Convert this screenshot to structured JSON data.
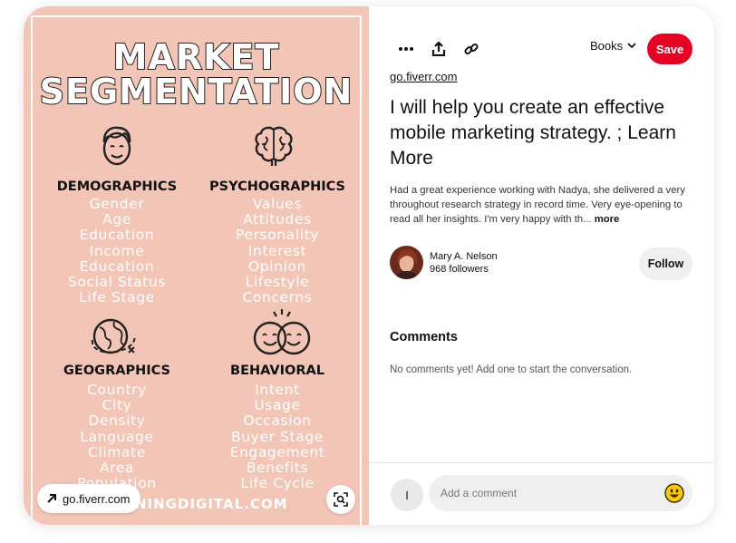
{
  "image": {
    "title_line1": "MARKET",
    "title_line2": "SEGMENTATION",
    "quadrants": [
      {
        "heading": "DEMOGRAPHICS",
        "items": [
          "Gender",
          "Age",
          "Education",
          "Income",
          "Education",
          "Social Status",
          "Life Stage"
        ],
        "icon": "face-icon"
      },
      {
        "heading": "PSYCHOGRAPHICS",
        "items": [
          "Values",
          "Attitudes",
          "Personality",
          "Interest",
          "Opinion",
          "Lifestyle",
          "Concerns"
        ],
        "icon": "brain-icon"
      },
      {
        "heading": "GEOGRAPHICS",
        "items": [
          "Country",
          "City",
          "Density",
          "Language",
          "Climate",
          "Area",
          "Population"
        ],
        "icon": "globe-icon"
      },
      {
        "heading": "BEHAVIORAL",
        "items": [
          "Intent",
          "Usage",
          "Occasion",
          "Buyer Stage",
          "Engagement",
          "Benefits",
          "Life Cycle"
        ],
        "icon": "happy-faces-icon"
      }
    ],
    "footer_brand": "…WNINGDIGITAL.COM",
    "source_chip": "go.fiverr.com",
    "background_color": "#f2c5b6"
  },
  "toolbar": {
    "more_icon": "more-dots-icon",
    "share_icon": "share-icon",
    "link_icon": "link-icon",
    "board": "Books",
    "save_label": "Save"
  },
  "pin": {
    "source": "go.fiverr.com",
    "title": "I will help you create an effective mobile marketing strategy. ; Learn More",
    "description": "Had a great experience working with Nadya, she delivered a very throughout research strategy in record time. Very eye-opening to read all her insights. I'm very happy with th...",
    "more_label": "more"
  },
  "author": {
    "name": "Mary A. Nelson",
    "followers": "968 followers",
    "follow_label": "Follow"
  },
  "comments": {
    "heading": "Comments",
    "empty_text": "No comments yet! Add one to start the conversation.",
    "user_initial": "I",
    "placeholder": "Add a comment"
  },
  "colors": {
    "accent": "#e60023",
    "image_bg": "#f2c5b6"
  }
}
